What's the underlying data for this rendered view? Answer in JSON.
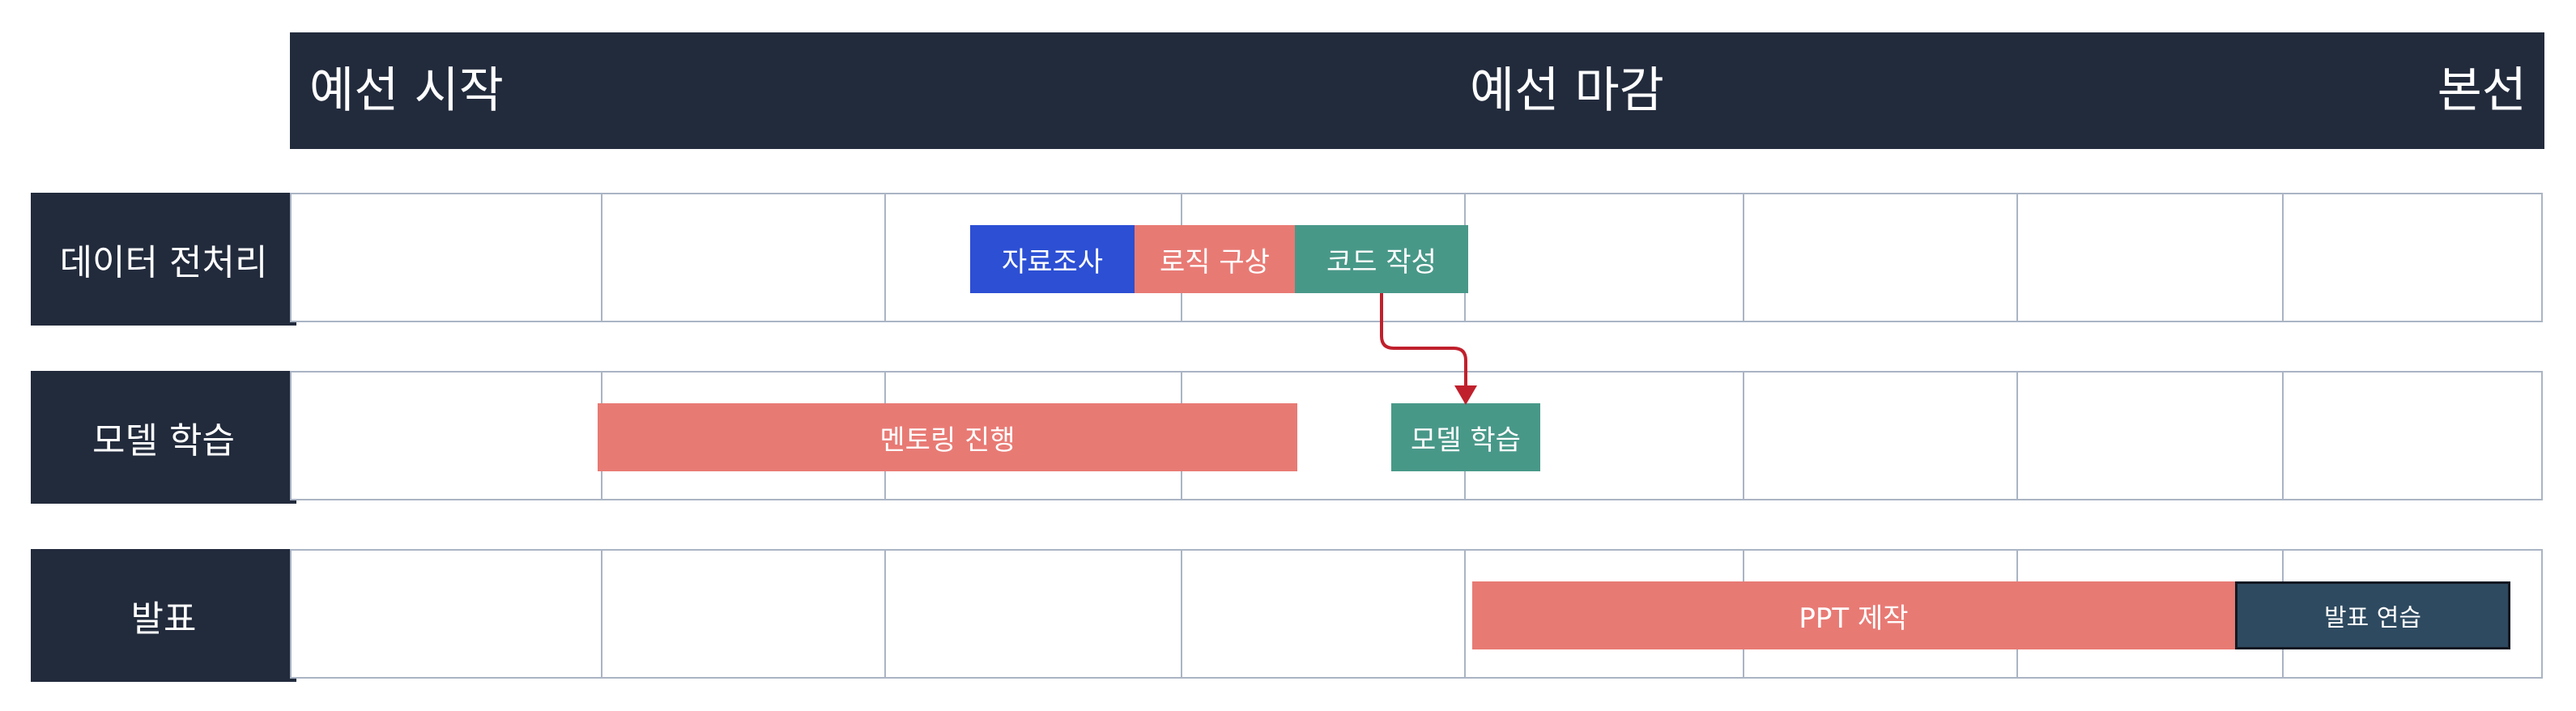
{
  "header": {
    "milestones": [
      "예선 시작",
      "예선 마감",
      "본선"
    ]
  },
  "lanes": [
    {
      "label": "데이터 전처리",
      "tasks": [
        {
          "label": "자료조사",
          "color": "#2c4fd4"
        },
        {
          "label": "로직 구상",
          "color": "#e87a74"
        },
        {
          "label": "코드 작성",
          "color": "#489888"
        }
      ]
    },
    {
      "label": "모델 학습",
      "tasks": [
        {
          "label": "멘토링 진행",
          "color": "#e87a74"
        },
        {
          "label": "모델 학습",
          "color": "#489888"
        }
      ]
    },
    {
      "label": "발표",
      "tasks": [
        {
          "label": "PPT 제작",
          "color": "#e87a74"
        },
        {
          "label": "발표 연습",
          "color": "#2e4a60"
        }
      ]
    }
  ],
  "colors": {
    "header_bg": "#222b3c",
    "grid_line": "#aab4c4",
    "dependency_arrow": "#c0202c"
  }
}
